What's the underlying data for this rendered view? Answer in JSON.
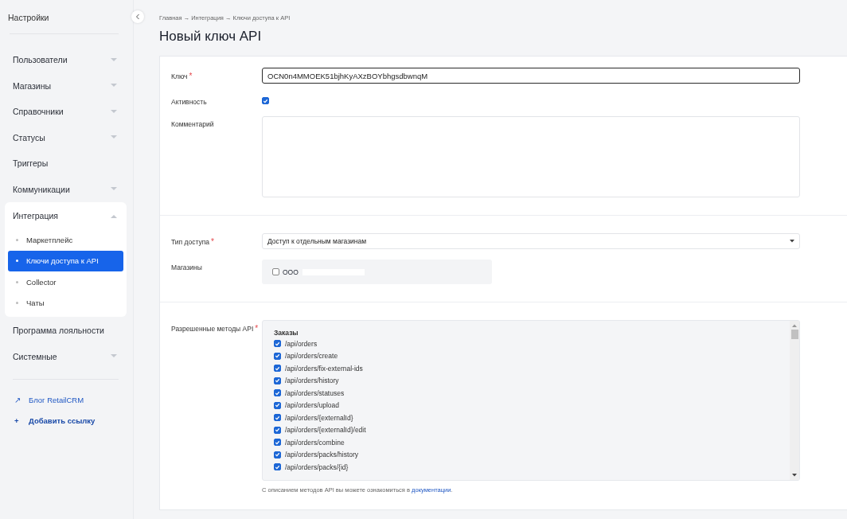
{
  "sidebar": {
    "title": "Настройки",
    "items": [
      {
        "label": "Пользователи",
        "kind": "group",
        "expanded": false
      },
      {
        "label": "Магазины",
        "kind": "group",
        "expanded": false
      },
      {
        "label": "Справочники",
        "kind": "group",
        "expanded": false
      },
      {
        "label": "Статусы",
        "kind": "group",
        "expanded": false
      },
      {
        "label": "Триггеры",
        "kind": "link"
      },
      {
        "label": "Коммуникации",
        "kind": "group",
        "expanded": false
      },
      {
        "label": "Интеграция",
        "kind": "group",
        "expanded": true,
        "children": [
          {
            "label": "Маркетплейс",
            "selected": false
          },
          {
            "label": "Ключи доступа к API",
            "selected": true
          },
          {
            "label": "Collector",
            "selected": false
          },
          {
            "label": "Чаты",
            "selected": false
          }
        ]
      },
      {
        "label": "Программа лояльности",
        "kind": "link"
      },
      {
        "label": "Системные",
        "kind": "group",
        "expanded": false
      }
    ],
    "links": [
      {
        "icon": "↗",
        "label": "Блог RetailCRM",
        "kind": "external"
      },
      {
        "icon": "+",
        "label": "Добавить ссылку",
        "kind": "add"
      }
    ]
  },
  "breadcrumb": "Главная → Интеграция → Ключи доступа к API",
  "title": "Новый ключ API",
  "form": {
    "key": {
      "label": "Ключ",
      "required_mark": "*",
      "value": "OCN0n4MMOEK51bjhKyAXzBOYbhgsdbwnqM"
    },
    "active": {
      "label": "Активность",
      "checked": true
    },
    "comment": {
      "label": "Комментарий"
    },
    "access_type": {
      "label": "Тип доступа",
      "required_mark": "*",
      "value": "Доступ к отдельным магазинам"
    },
    "shops": {
      "label": "Магазины",
      "items": [
        {
          "label": "ООО",
          "checked": false
        }
      ]
    },
    "methods": {
      "label": "Разрешенные методы API",
      "required_mark": "*",
      "group": "Заказы",
      "items": [
        {
          "label": "/api/orders",
          "checked": true
        },
        {
          "label": "/api/orders/create",
          "checked": true
        },
        {
          "label": "/api/orders/fix-external-ids",
          "checked": true
        },
        {
          "label": "/api/orders/history",
          "checked": true
        },
        {
          "label": "/api/orders/statuses",
          "checked": true
        },
        {
          "label": "/api/orders/upload",
          "checked": true
        },
        {
          "label": "/api/orders/{externalId}",
          "checked": true
        },
        {
          "label": "/api/orders/{externalId}/edit",
          "checked": true
        },
        {
          "label": "/api/orders/combine",
          "checked": true
        },
        {
          "label": "/api/orders/packs/history",
          "checked": true
        },
        {
          "label": "/api/orders/packs/{id}",
          "checked": true
        }
      ]
    },
    "note": {
      "text": "С описанием методов API вы можете ознакомиться в",
      "link": "документации",
      "end": "."
    }
  }
}
